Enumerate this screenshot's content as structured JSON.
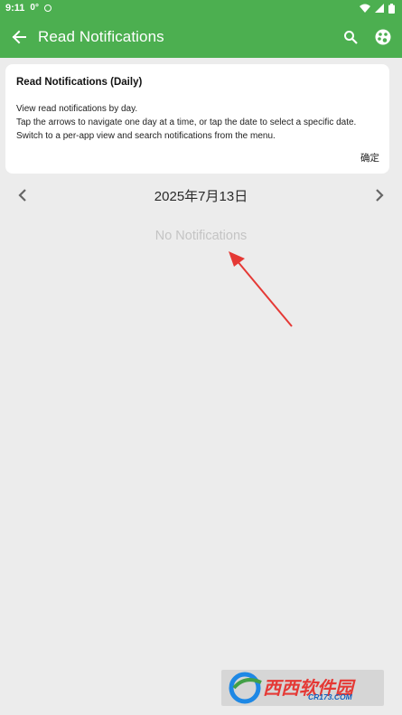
{
  "status_bar": {
    "time": "9:11",
    "temp": "0°"
  },
  "app_bar": {
    "title": "Read Notifications"
  },
  "info_card": {
    "title": "Read Notifications (Daily)",
    "lines": [
      "View read notifications by day.",
      "Tap the arrows to navigate one day at a time, or tap the date to select a specific date.",
      "Switch to a per-app view and search notifications from the menu."
    ],
    "confirm_label": "确定"
  },
  "date_nav": {
    "date": "2025年7月13日"
  },
  "empty_state": {
    "text": "No Notifications"
  },
  "watermark": {
    "text": "西西软件园",
    "sub": "CR173.COM"
  },
  "colors": {
    "primary": "#4caf50",
    "background": "#ececec",
    "arrow": "#e53935"
  }
}
